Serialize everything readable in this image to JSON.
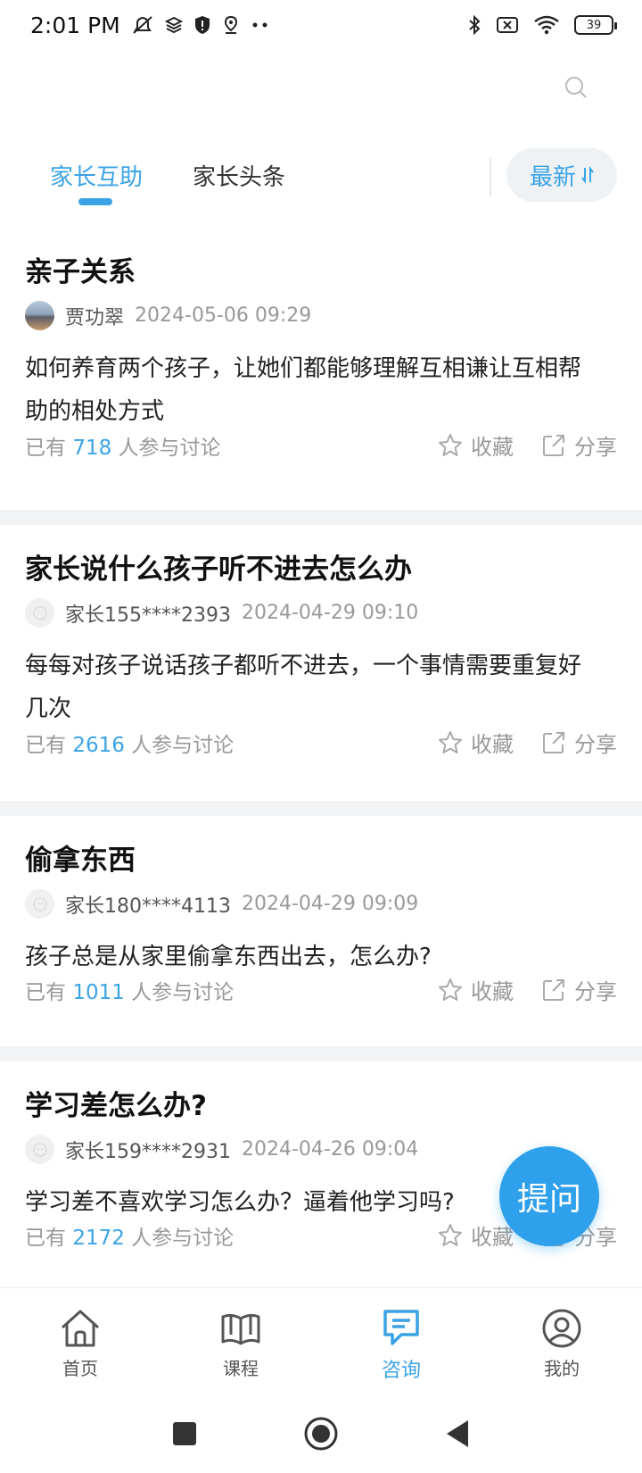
{
  "status_bar": {
    "time": "2:01 PM",
    "battery": "39"
  },
  "tabs": [
    {
      "label": "家长互助",
      "active": true
    },
    {
      "label": "家长头条",
      "active": false
    }
  ],
  "sort": {
    "label": "最新"
  },
  "posts": [
    {
      "title": "亲子关系",
      "author": "贾功翠",
      "date": "2024-05-06 09:29",
      "content": "如何养育两个孩子，让她们都能够理解互相谦让互相帮助的相处方式",
      "participants_prefix": "已有",
      "participants_count": "718",
      "participants_suffix": "人参与讨论",
      "favorite": "收藏",
      "share": "分享"
    },
    {
      "title": "家长说什么孩子听不进去怎么办",
      "author": "家长155****2393",
      "date": "2024-04-29 09:10",
      "content": "每每对孩子说话孩子都听不进去，一个事情需要重复好几次",
      "participants_prefix": "已有",
      "participants_count": "2616",
      "participants_suffix": "人参与讨论",
      "favorite": "收藏",
      "share": "分享"
    },
    {
      "title": "偷拿东西",
      "author": "家长180****4113",
      "date": "2024-04-29 09:09",
      "content": "孩子总是从家里偷拿东西出去，怎么办?",
      "participants_prefix": "已有",
      "participants_count": "1011",
      "participants_suffix": "人参与讨论",
      "favorite": "收藏",
      "share": "分享"
    },
    {
      "title": "学习差怎么办?",
      "author": "家长159****2931",
      "date": "2024-04-26 09:04",
      "content": "学习差不喜欢学习怎么办？逼着他学习吗?",
      "participants_prefix": "已有",
      "participants_count": "2172",
      "participants_suffix": "人参与讨论",
      "favorite": "收藏",
      "share": "分享"
    }
  ],
  "fab": {
    "label": "提问"
  },
  "bottom_nav": [
    {
      "label": "首页",
      "icon": "home-icon"
    },
    {
      "label": "课程",
      "icon": "book-icon"
    },
    {
      "label": "咨询",
      "icon": "chat-icon",
      "active": true
    },
    {
      "label": "我的",
      "icon": "profile-icon"
    }
  ],
  "colors": {
    "accent": "#3aa3e6",
    "fab": "#2fa0ec",
    "muted": "#999999"
  }
}
